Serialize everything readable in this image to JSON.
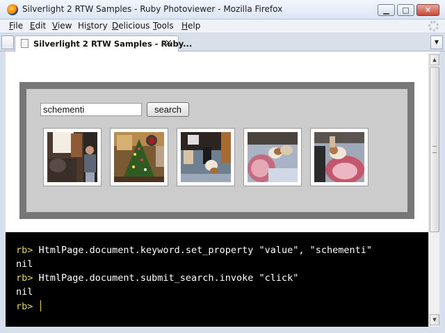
{
  "window": {
    "title": "Silverlight 2 RTW Samples - Ruby Photoviewer - Mozilla Firefox",
    "controls": {
      "minimize": "▁",
      "maximize": "□",
      "close": "✕"
    }
  },
  "menu": [
    {
      "underline": "F",
      "rest": "ile"
    },
    {
      "underline": "E",
      "rest": "dit"
    },
    {
      "underline": "V",
      "rest": "iew"
    },
    {
      "pre": "Hi",
      "underline": "s",
      "rest": "tory"
    },
    {
      "underline": "D",
      "rest": "elicious"
    },
    {
      "underline": "T",
      "rest": "ools"
    },
    {
      "underline": "H",
      "rest": "elp"
    }
  ],
  "tabs": [
    {
      "label": "Silverlight 2 RTW Samples - Ruby...",
      "close": "✕",
      "active": true
    }
  ],
  "tab_list_icon": "▼",
  "viewer": {
    "search_value": "schementi",
    "search_button": "search",
    "thumbnails": [
      {
        "subject": "person-in-living-room"
      },
      {
        "subject": "christmas-tree"
      },
      {
        "subject": "puppy-on-floor"
      },
      {
        "subject": "puppies-on-blanket"
      },
      {
        "subject": "puppy-on-lap"
      }
    ]
  },
  "console": {
    "lines": [
      {
        "prompt": "rb> ",
        "text": "HtmlPage.document.keyword.set_property \"value\", \"schementi\""
      },
      {
        "prompt": "",
        "text": "nil"
      },
      {
        "prompt": "rb> ",
        "text": "HtmlPage.document.submit_search.invoke \"click\""
      },
      {
        "prompt": "",
        "text": "nil"
      },
      {
        "prompt": "rb> ",
        "text": ""
      }
    ]
  },
  "colors": {
    "console_bg": "#000000",
    "prompt": "#e6d64a",
    "viewer_frame": "#777777",
    "viewer_panel": "#cccccc"
  }
}
